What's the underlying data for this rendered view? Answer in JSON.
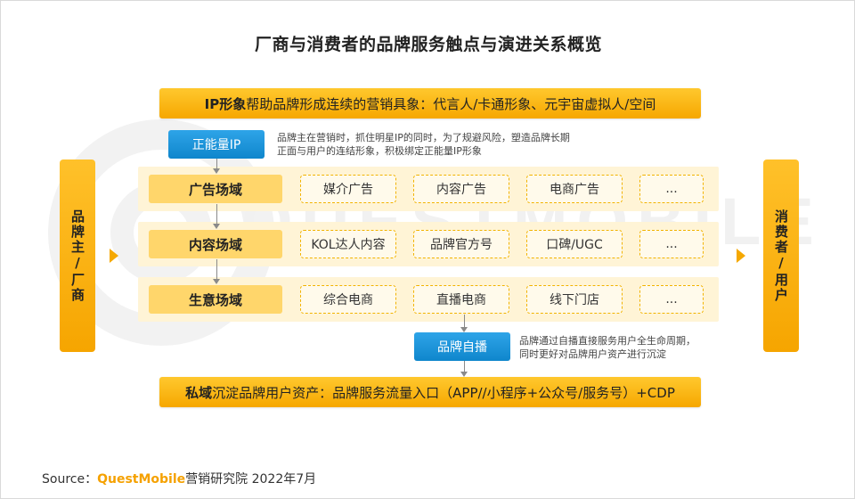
{
  "title": "厂商与消费者的品牌服务触点与演进关系概览",
  "watermark": "QUESTMOBILE",
  "left_side": "品牌主/厂商",
  "right_side": "消费者/用户",
  "top_bar": {
    "bold": "IP形象",
    "text": "帮助品牌形成连续的营销具象：代言人/卡通形象、元宇宙虚拟人/空间"
  },
  "badge_ip": {
    "label": "正能量IP",
    "note_line1": "品牌主在营销时，抓住明星IP的同时，为了规避风险，塑造品牌长期",
    "note_line2": "正面与用户的连结形象，积极绑定正能量IP形象"
  },
  "fields": [
    {
      "label": "广告场域",
      "items": [
        "媒介广告",
        "内容广告",
        "电商广告",
        "..."
      ]
    },
    {
      "label": "内容场域",
      "items": [
        "KOL达人内容",
        "品牌官方号",
        "口碑/UGC",
        "..."
      ]
    },
    {
      "label": "生意场域",
      "items": [
        "综合电商",
        "直播电商",
        "线下门店",
        "..."
      ]
    }
  ],
  "badge_self": {
    "label": "品牌自播",
    "note_line1": "品牌通过自播直接服务用户全生命周期，",
    "note_line2": "同时更好对品牌用户资产进行沉淀"
  },
  "bottom_bar": {
    "bold": "私域",
    "text": "沉淀品牌用户资产：品牌服务流量入口（APP//小程序+公众号/服务号）+CDP"
  },
  "source": {
    "prefix": "Source：",
    "brand": "QuestMobile",
    "suffix": "营销研究院 2022年7月"
  },
  "colors": {
    "accent": "#f6a700",
    "band": "#fff4d6",
    "blue": "#0f86cc",
    "dash": "#f2b300"
  }
}
